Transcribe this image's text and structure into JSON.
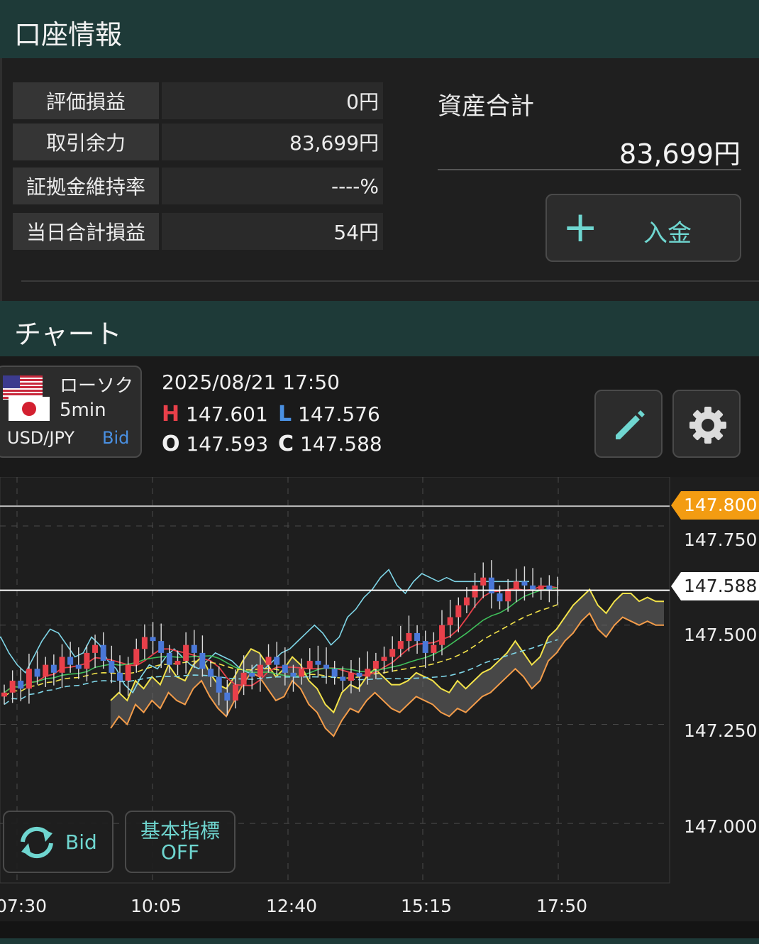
{
  "account": {
    "title": "口座情報",
    "rows": [
      {
        "label": "評価損益",
        "value": "0円"
      },
      {
        "label": "取引余力",
        "value": "83,699円"
      },
      {
        "label": "証拠金維持率",
        "value": "----%"
      },
      {
        "label": "当日合計損益",
        "value": "54円"
      }
    ],
    "total_label": "資産合計",
    "total_value": "83,699円",
    "deposit_label": "入金",
    "deposit_icon": "plus-icon"
  },
  "chart_section": {
    "title": "チャート",
    "chart_kind": "ローソク",
    "interval": "5min",
    "pair": "USD/JPY",
    "price_side": "Bid",
    "datetime": "2025/08/21 17:50",
    "ohlc": {
      "H": "147.601",
      "L": "147.576",
      "O": "147.593",
      "C": "147.588"
    },
    "high_letter": "H",
    "low_letter": "L",
    "open_letter": "O",
    "close_letter": "C",
    "edit_icon": "pencil-icon",
    "settings_icon": "gear-icon",
    "refresh_label": "Bid",
    "indicator_label_1": "基本指標",
    "indicator_label_2": "OFF",
    "colors": {
      "header_bg": "#1e3a38",
      "accent_teal": "#6fd6d0",
      "candle_up": "#e8404a",
      "candle_down": "#4a78d8",
      "high_letter": "#e8404a",
      "low_letter": "#4a90e2",
      "alert_line_tag": "#f39c12"
    }
  },
  "chart_data": {
    "type": "candlestick",
    "symbol": "USD/JPY",
    "interval": "5min",
    "x_tick_labels": [
      "07:30",
      "10:05",
      "12:40",
      "15:15",
      "17:50"
    ],
    "y_tick_labels": [
      "147.750",
      "147.500",
      "147.250",
      "147.000"
    ],
    "ylim": [
      146.85,
      147.87
    ],
    "alert_price": "147.800",
    "current_price": "147.588",
    "grid": true,
    "candles_approx": [
      147.33,
      147.36,
      147.34,
      147.39,
      147.37,
      147.4,
      147.38,
      147.42,
      147.4,
      147.39,
      147.43,
      147.45,
      147.41,
      147.38,
      147.36,
      147.4,
      147.44,
      147.47,
      147.46,
      147.43,
      147.4,
      147.41,
      147.45,
      147.43,
      147.39,
      147.37,
      147.33,
      147.31,
      147.35,
      147.38,
      147.37,
      147.4,
      147.42,
      147.4,
      147.38,
      147.37,
      147.39,
      147.41,
      147.4,
      147.39,
      147.37,
      147.36,
      147.38,
      147.37,
      147.39,
      147.41,
      147.42,
      147.44,
      147.46,
      147.48,
      147.46,
      147.43,
      147.45,
      147.5,
      147.52,
      147.55,
      147.57,
      147.6,
      147.62,
      147.58,
      147.56,
      147.59,
      147.61,
      147.6,
      147.59,
      147.6,
      147.59,
      147.59
    ]
  }
}
